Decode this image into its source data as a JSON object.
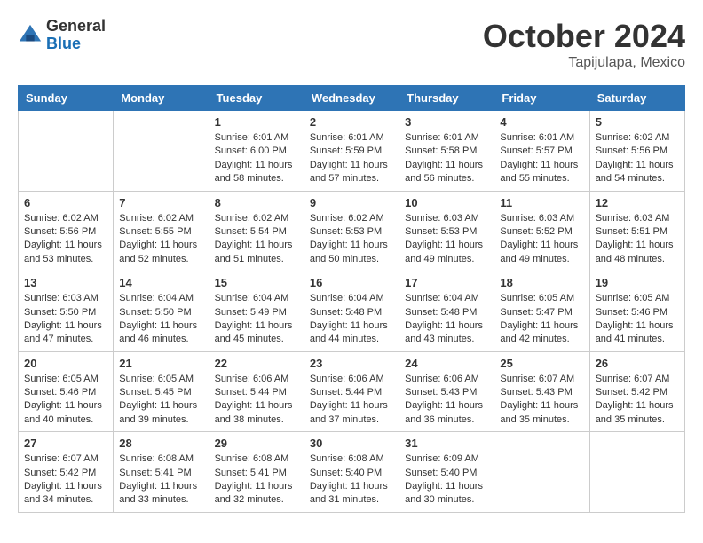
{
  "header": {
    "logo_general": "General",
    "logo_blue": "Blue",
    "month_title": "October 2024",
    "location": "Tapijulapa, Mexico"
  },
  "weekdays": [
    "Sunday",
    "Monday",
    "Tuesday",
    "Wednesday",
    "Thursday",
    "Friday",
    "Saturday"
  ],
  "weeks": [
    [
      {
        "day": "",
        "sunrise": "",
        "sunset": "",
        "daylight": ""
      },
      {
        "day": "",
        "sunrise": "",
        "sunset": "",
        "daylight": ""
      },
      {
        "day": "1",
        "sunrise": "Sunrise: 6:01 AM",
        "sunset": "Sunset: 6:00 PM",
        "daylight": "Daylight: 11 hours and 58 minutes."
      },
      {
        "day": "2",
        "sunrise": "Sunrise: 6:01 AM",
        "sunset": "Sunset: 5:59 PM",
        "daylight": "Daylight: 11 hours and 57 minutes."
      },
      {
        "day": "3",
        "sunrise": "Sunrise: 6:01 AM",
        "sunset": "Sunset: 5:58 PM",
        "daylight": "Daylight: 11 hours and 56 minutes."
      },
      {
        "day": "4",
        "sunrise": "Sunrise: 6:01 AM",
        "sunset": "Sunset: 5:57 PM",
        "daylight": "Daylight: 11 hours and 55 minutes."
      },
      {
        "day": "5",
        "sunrise": "Sunrise: 6:02 AM",
        "sunset": "Sunset: 5:56 PM",
        "daylight": "Daylight: 11 hours and 54 minutes."
      }
    ],
    [
      {
        "day": "6",
        "sunrise": "Sunrise: 6:02 AM",
        "sunset": "Sunset: 5:56 PM",
        "daylight": "Daylight: 11 hours and 53 minutes."
      },
      {
        "day": "7",
        "sunrise": "Sunrise: 6:02 AM",
        "sunset": "Sunset: 5:55 PM",
        "daylight": "Daylight: 11 hours and 52 minutes."
      },
      {
        "day": "8",
        "sunrise": "Sunrise: 6:02 AM",
        "sunset": "Sunset: 5:54 PM",
        "daylight": "Daylight: 11 hours and 51 minutes."
      },
      {
        "day": "9",
        "sunrise": "Sunrise: 6:02 AM",
        "sunset": "Sunset: 5:53 PM",
        "daylight": "Daylight: 11 hours and 50 minutes."
      },
      {
        "day": "10",
        "sunrise": "Sunrise: 6:03 AM",
        "sunset": "Sunset: 5:53 PM",
        "daylight": "Daylight: 11 hours and 49 minutes."
      },
      {
        "day": "11",
        "sunrise": "Sunrise: 6:03 AM",
        "sunset": "Sunset: 5:52 PM",
        "daylight": "Daylight: 11 hours and 49 minutes."
      },
      {
        "day": "12",
        "sunrise": "Sunrise: 6:03 AM",
        "sunset": "Sunset: 5:51 PM",
        "daylight": "Daylight: 11 hours and 48 minutes."
      }
    ],
    [
      {
        "day": "13",
        "sunrise": "Sunrise: 6:03 AM",
        "sunset": "Sunset: 5:50 PM",
        "daylight": "Daylight: 11 hours and 47 minutes."
      },
      {
        "day": "14",
        "sunrise": "Sunrise: 6:04 AM",
        "sunset": "Sunset: 5:50 PM",
        "daylight": "Daylight: 11 hours and 46 minutes."
      },
      {
        "day": "15",
        "sunrise": "Sunrise: 6:04 AM",
        "sunset": "Sunset: 5:49 PM",
        "daylight": "Daylight: 11 hours and 45 minutes."
      },
      {
        "day": "16",
        "sunrise": "Sunrise: 6:04 AM",
        "sunset": "Sunset: 5:48 PM",
        "daylight": "Daylight: 11 hours and 44 minutes."
      },
      {
        "day": "17",
        "sunrise": "Sunrise: 6:04 AM",
        "sunset": "Sunset: 5:48 PM",
        "daylight": "Daylight: 11 hours and 43 minutes."
      },
      {
        "day": "18",
        "sunrise": "Sunrise: 6:05 AM",
        "sunset": "Sunset: 5:47 PM",
        "daylight": "Daylight: 11 hours and 42 minutes."
      },
      {
        "day": "19",
        "sunrise": "Sunrise: 6:05 AM",
        "sunset": "Sunset: 5:46 PM",
        "daylight": "Daylight: 11 hours and 41 minutes."
      }
    ],
    [
      {
        "day": "20",
        "sunrise": "Sunrise: 6:05 AM",
        "sunset": "Sunset: 5:46 PM",
        "daylight": "Daylight: 11 hours and 40 minutes."
      },
      {
        "day": "21",
        "sunrise": "Sunrise: 6:05 AM",
        "sunset": "Sunset: 5:45 PM",
        "daylight": "Daylight: 11 hours and 39 minutes."
      },
      {
        "day": "22",
        "sunrise": "Sunrise: 6:06 AM",
        "sunset": "Sunset: 5:44 PM",
        "daylight": "Daylight: 11 hours and 38 minutes."
      },
      {
        "day": "23",
        "sunrise": "Sunrise: 6:06 AM",
        "sunset": "Sunset: 5:44 PM",
        "daylight": "Daylight: 11 hours and 37 minutes."
      },
      {
        "day": "24",
        "sunrise": "Sunrise: 6:06 AM",
        "sunset": "Sunset: 5:43 PM",
        "daylight": "Daylight: 11 hours and 36 minutes."
      },
      {
        "day": "25",
        "sunrise": "Sunrise: 6:07 AM",
        "sunset": "Sunset: 5:43 PM",
        "daylight": "Daylight: 11 hours and 35 minutes."
      },
      {
        "day": "26",
        "sunrise": "Sunrise: 6:07 AM",
        "sunset": "Sunset: 5:42 PM",
        "daylight": "Daylight: 11 hours and 35 minutes."
      }
    ],
    [
      {
        "day": "27",
        "sunrise": "Sunrise: 6:07 AM",
        "sunset": "Sunset: 5:42 PM",
        "daylight": "Daylight: 11 hours and 34 minutes."
      },
      {
        "day": "28",
        "sunrise": "Sunrise: 6:08 AM",
        "sunset": "Sunset: 5:41 PM",
        "daylight": "Daylight: 11 hours and 33 minutes."
      },
      {
        "day": "29",
        "sunrise": "Sunrise: 6:08 AM",
        "sunset": "Sunset: 5:41 PM",
        "daylight": "Daylight: 11 hours and 32 minutes."
      },
      {
        "day": "30",
        "sunrise": "Sunrise: 6:08 AM",
        "sunset": "Sunset: 5:40 PM",
        "daylight": "Daylight: 11 hours and 31 minutes."
      },
      {
        "day": "31",
        "sunrise": "Sunrise: 6:09 AM",
        "sunset": "Sunset: 5:40 PM",
        "daylight": "Daylight: 11 hours and 30 minutes."
      },
      {
        "day": "",
        "sunrise": "",
        "sunset": "",
        "daylight": ""
      },
      {
        "day": "",
        "sunrise": "",
        "sunset": "",
        "daylight": ""
      }
    ]
  ]
}
